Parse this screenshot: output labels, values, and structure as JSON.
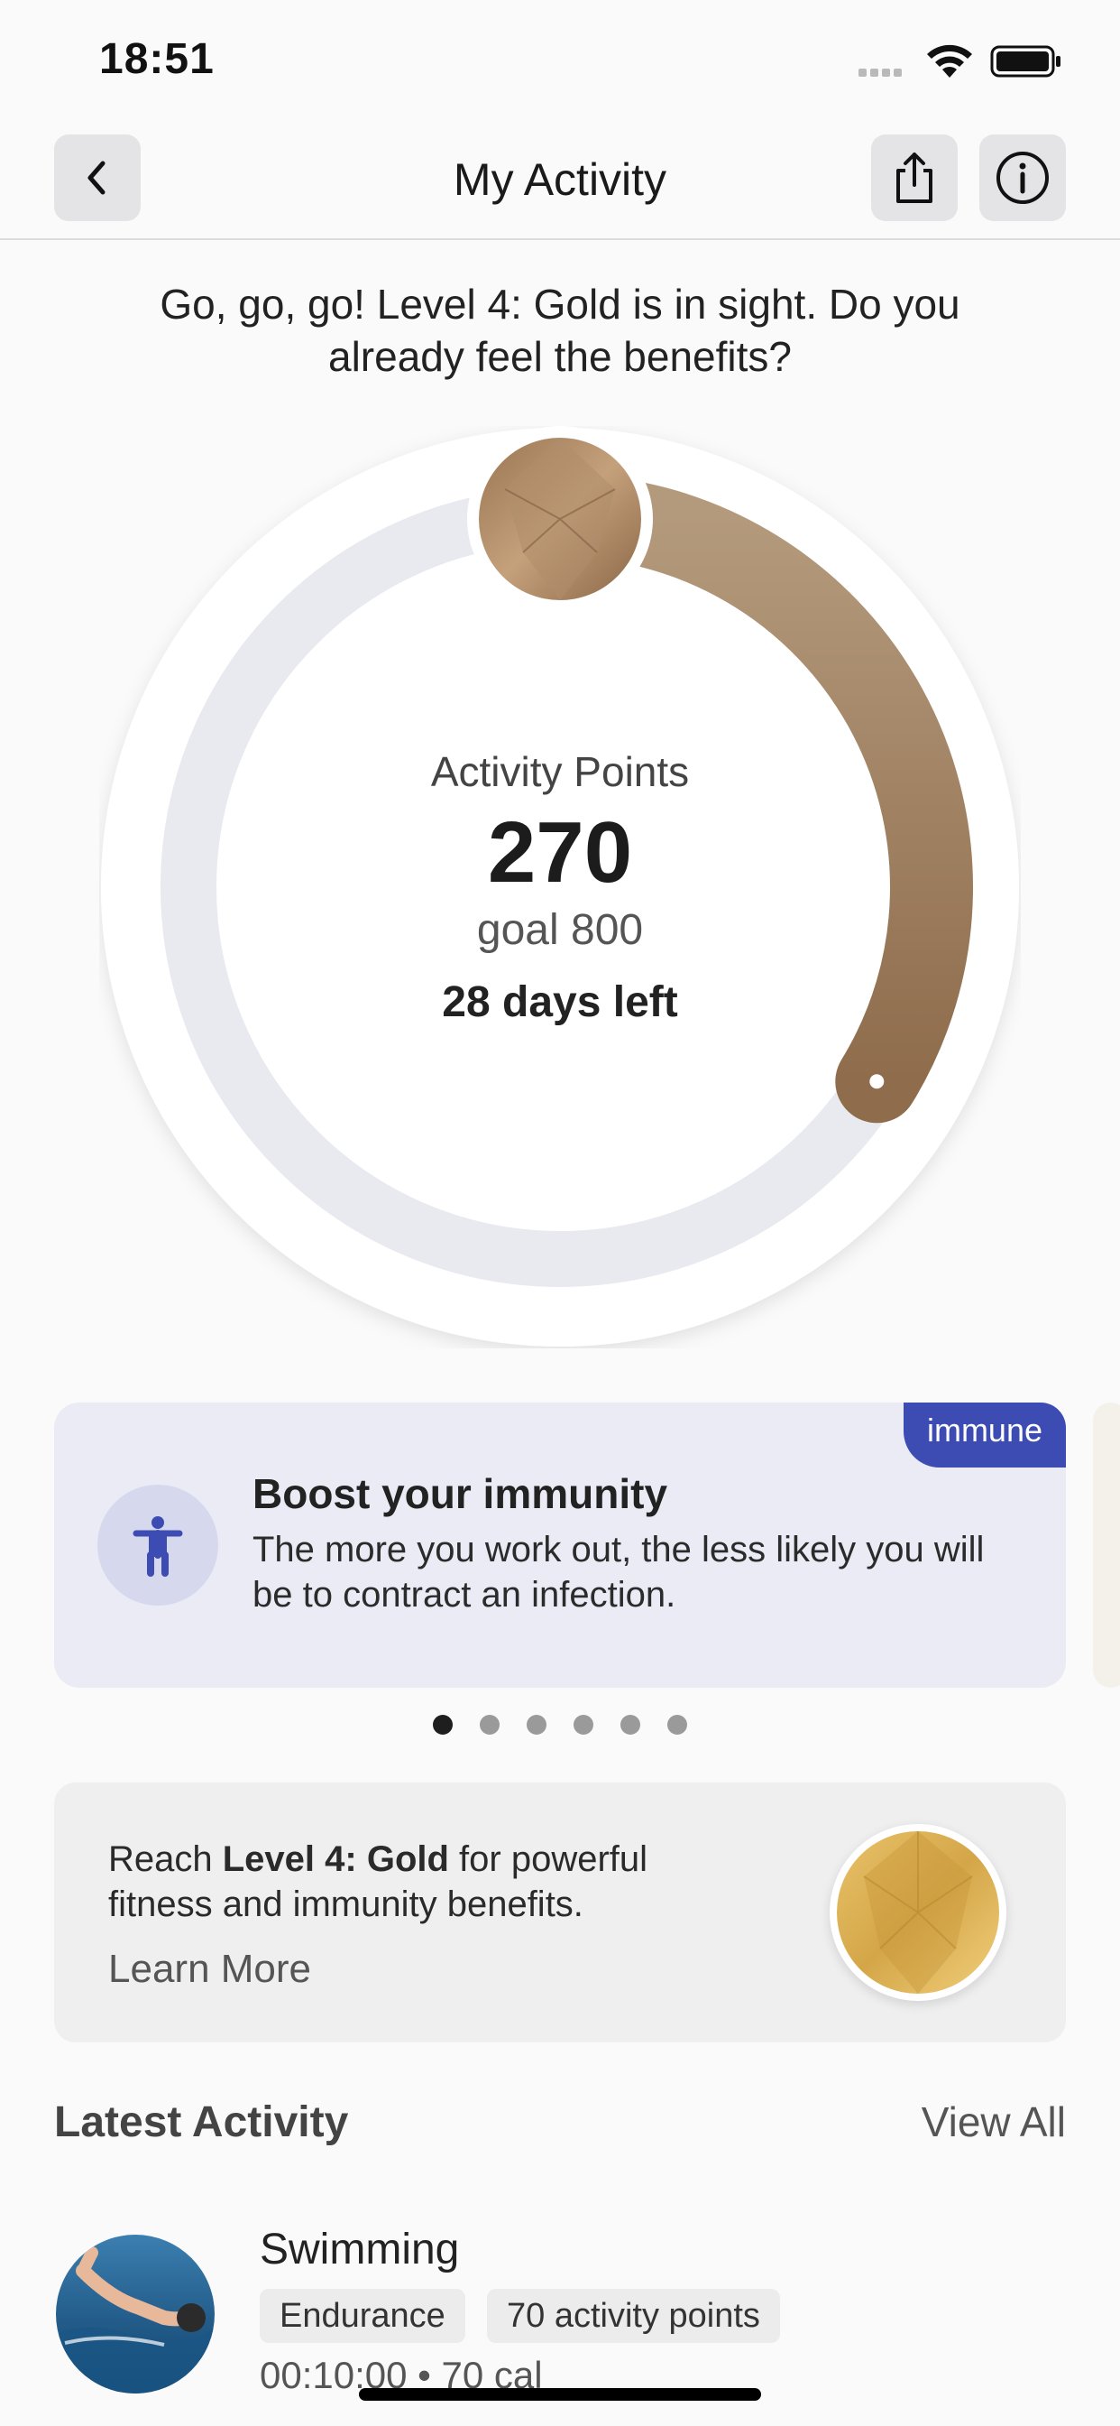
{
  "status": {
    "time": "18:51"
  },
  "nav": {
    "title": "My Activity"
  },
  "intro": "Go, go, go! Level 4: Gold is in sight. Do you already feel the benefits?",
  "progress": {
    "label": "Activity Points",
    "points": "270",
    "goal": "goal 800",
    "days_left": "28 days left",
    "fraction": 0.3375,
    "colors": {
      "track": "#e9eaf0",
      "fill_start": "#8e6c4c",
      "fill_end": "#c9ad8b"
    }
  },
  "tip": {
    "badge": "immune",
    "title": "Boost your immunity",
    "text": "The more you work out, the less likely you will be to contract an infection.",
    "icon": "person-icon"
  },
  "pager": {
    "count": 6,
    "active": 0
  },
  "level_card": {
    "text_pre": "Reach ",
    "text_bold": "Level 4: Gold",
    "text_post": " for powerful fitness and immunity benefits.",
    "link": "Learn More"
  },
  "latest": {
    "heading": "Latest Activity",
    "view_all": "View All",
    "items": [
      {
        "title": "Swimming",
        "tags": [
          "Endurance",
          "70 activity points"
        ],
        "meta": "00:10:00 • 70 cal"
      }
    ]
  }
}
